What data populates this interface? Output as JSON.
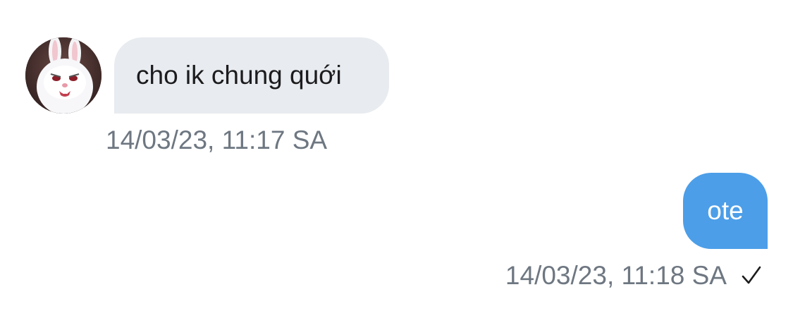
{
  "conversation": {
    "incoming": {
      "text": "cho ik chung quới",
      "timestamp": "14/03/23, 11:17 SA",
      "avatar_icon": "bunny-avatar"
    },
    "outgoing": {
      "text": "ote",
      "timestamp": "14/03/23, 11:18 SA",
      "status_icon": "checkmark-icon"
    }
  },
  "colors": {
    "incoming_bubble": "#e8ebef",
    "outgoing_bubble": "#4c9ee8",
    "timestamp": "#6e7781"
  }
}
